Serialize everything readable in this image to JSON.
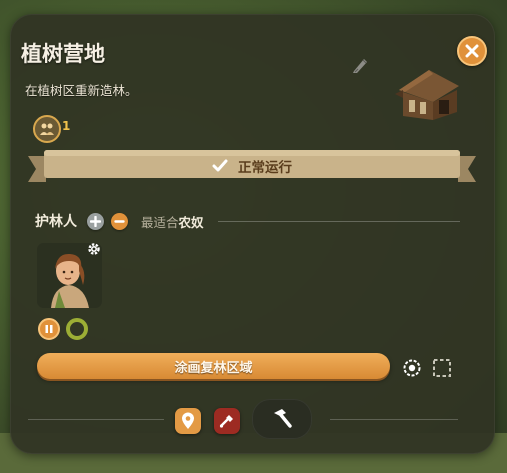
{
  "building": {
    "title": "植树营地",
    "description": "在植树区重新造林。",
    "workers_count": "1"
  },
  "status": {
    "label": "正常运行"
  },
  "workers_section": {
    "title": "护林人",
    "best_fit_prefix": "最适合",
    "best_fit_type": "农奴"
  },
  "actions": {
    "paint_area_label": "涂画复林区域"
  },
  "icons": {
    "close": "close-icon",
    "pencil": "pencil-icon",
    "workers": "workers-icon",
    "check": "checkmark-icon",
    "plus": "plus-icon",
    "minus": "minus-icon",
    "gear": "gear-icon",
    "pause": "pause-icon",
    "target": "target-icon",
    "select": "select-area-icon",
    "location": "location-pin-icon",
    "demolish": "demolish-shovel-icon",
    "build": "hammer-icon"
  },
  "colors": {
    "accent": "#e0913a",
    "panel": "#303424",
    "status_banner": "#c9b38a",
    "ring_green": "#9cae35",
    "demolish_red": "#9d2b22"
  }
}
